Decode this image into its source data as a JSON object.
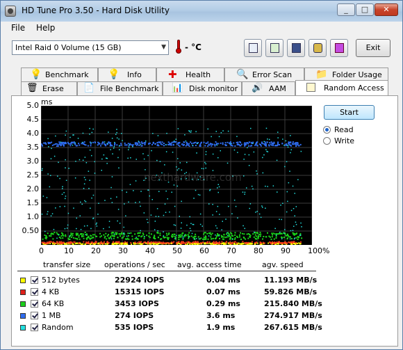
{
  "window": {
    "title": "HD Tune Pro 3.50 - Hard Disk Utility"
  },
  "titlebar_buttons": {
    "minimize": "_",
    "maximize": "□",
    "close": "✕"
  },
  "menu": [
    "File",
    "Help"
  ],
  "toolbar": {
    "drive": "Intel   Raid 0 Volume (15 GB)",
    "temperature": "- °C",
    "exit_label": "Exit",
    "buttons": [
      "copy-info-icon",
      "copy-screen-icon",
      "save-icon",
      "options-icon",
      "download-icon"
    ]
  },
  "tabs_row1": [
    "Benchmark",
    "Info",
    "Health",
    "Error Scan",
    "Folder Usage"
  ],
  "tabs_row2": [
    "Erase",
    "File Benchmark",
    "Disk monitor",
    "AAM",
    "Random Access"
  ],
  "active_tab": "Random Access",
  "controls": {
    "start_label": "Start",
    "read_label": "Read",
    "write_label": "Write",
    "mode": "Read"
  },
  "watermark": "nexthardware.com",
  "chart_data": {
    "type": "scatter",
    "ylabel": "ms",
    "xlabel": "",
    "ylim": [
      0,
      5.0
    ],
    "xlim": [
      0,
      100
    ],
    "y_ticks": [
      "5.0",
      "4.5",
      "4.0",
      "3.5",
      "3.0",
      "2.5",
      "2.0",
      "1.5",
      "1.0",
      "0.50"
    ],
    "x_ticks": [
      "0",
      "10",
      "20",
      "30",
      "40",
      "50",
      "60",
      "70",
      "80",
      "90",
      "100%"
    ],
    "grid": true,
    "series": [
      {
        "color": "#ffff00",
        "value_ms": 0.04,
        "band": [
          0.02,
          0.07
        ]
      },
      {
        "color": "#ff3b1d",
        "value_ms": 0.07,
        "band": [
          0.05,
          0.12
        ]
      },
      {
        "color": "#1bd61b",
        "value_ms": 0.29,
        "band": [
          0.2,
          0.45
        ]
      },
      {
        "color": "#2f6df0",
        "value_ms": 3.6,
        "band": [
          3.55,
          3.7
        ]
      },
      {
        "color": "#23e0e0",
        "value_ms": 1.9,
        "band": [
          0.2,
          4.2
        ]
      }
    ]
  },
  "stats": {
    "headers": [
      "transfer size",
      "operations / sec",
      "avg. access time",
      "agv. speed"
    ],
    "rows": [
      {
        "color": "#ffff00",
        "size": "512 bytes",
        "ops": "22924 IOPS",
        "access": "0.04 ms",
        "speed": "11.193 MB/s"
      },
      {
        "color": "#e0201a",
        "size": "4 KB",
        "ops": "15315 IOPS",
        "access": "0.07 ms",
        "speed": "59.826 MB/s"
      },
      {
        "color": "#1bcf1b",
        "size": "64 KB",
        "ops": "3453 IOPS",
        "access": "0.29 ms",
        "speed": "215.840 MB/s"
      },
      {
        "color": "#2f6df0",
        "size": "1 MB",
        "ops": "274 IOPS",
        "access": "3.6 ms",
        "speed": "274.917 MB/s"
      },
      {
        "color": "#23e0e0",
        "size": "Random",
        "ops": "535 IOPS",
        "access": "1.9 ms",
        "speed": "267.615 MB/s"
      }
    ]
  }
}
